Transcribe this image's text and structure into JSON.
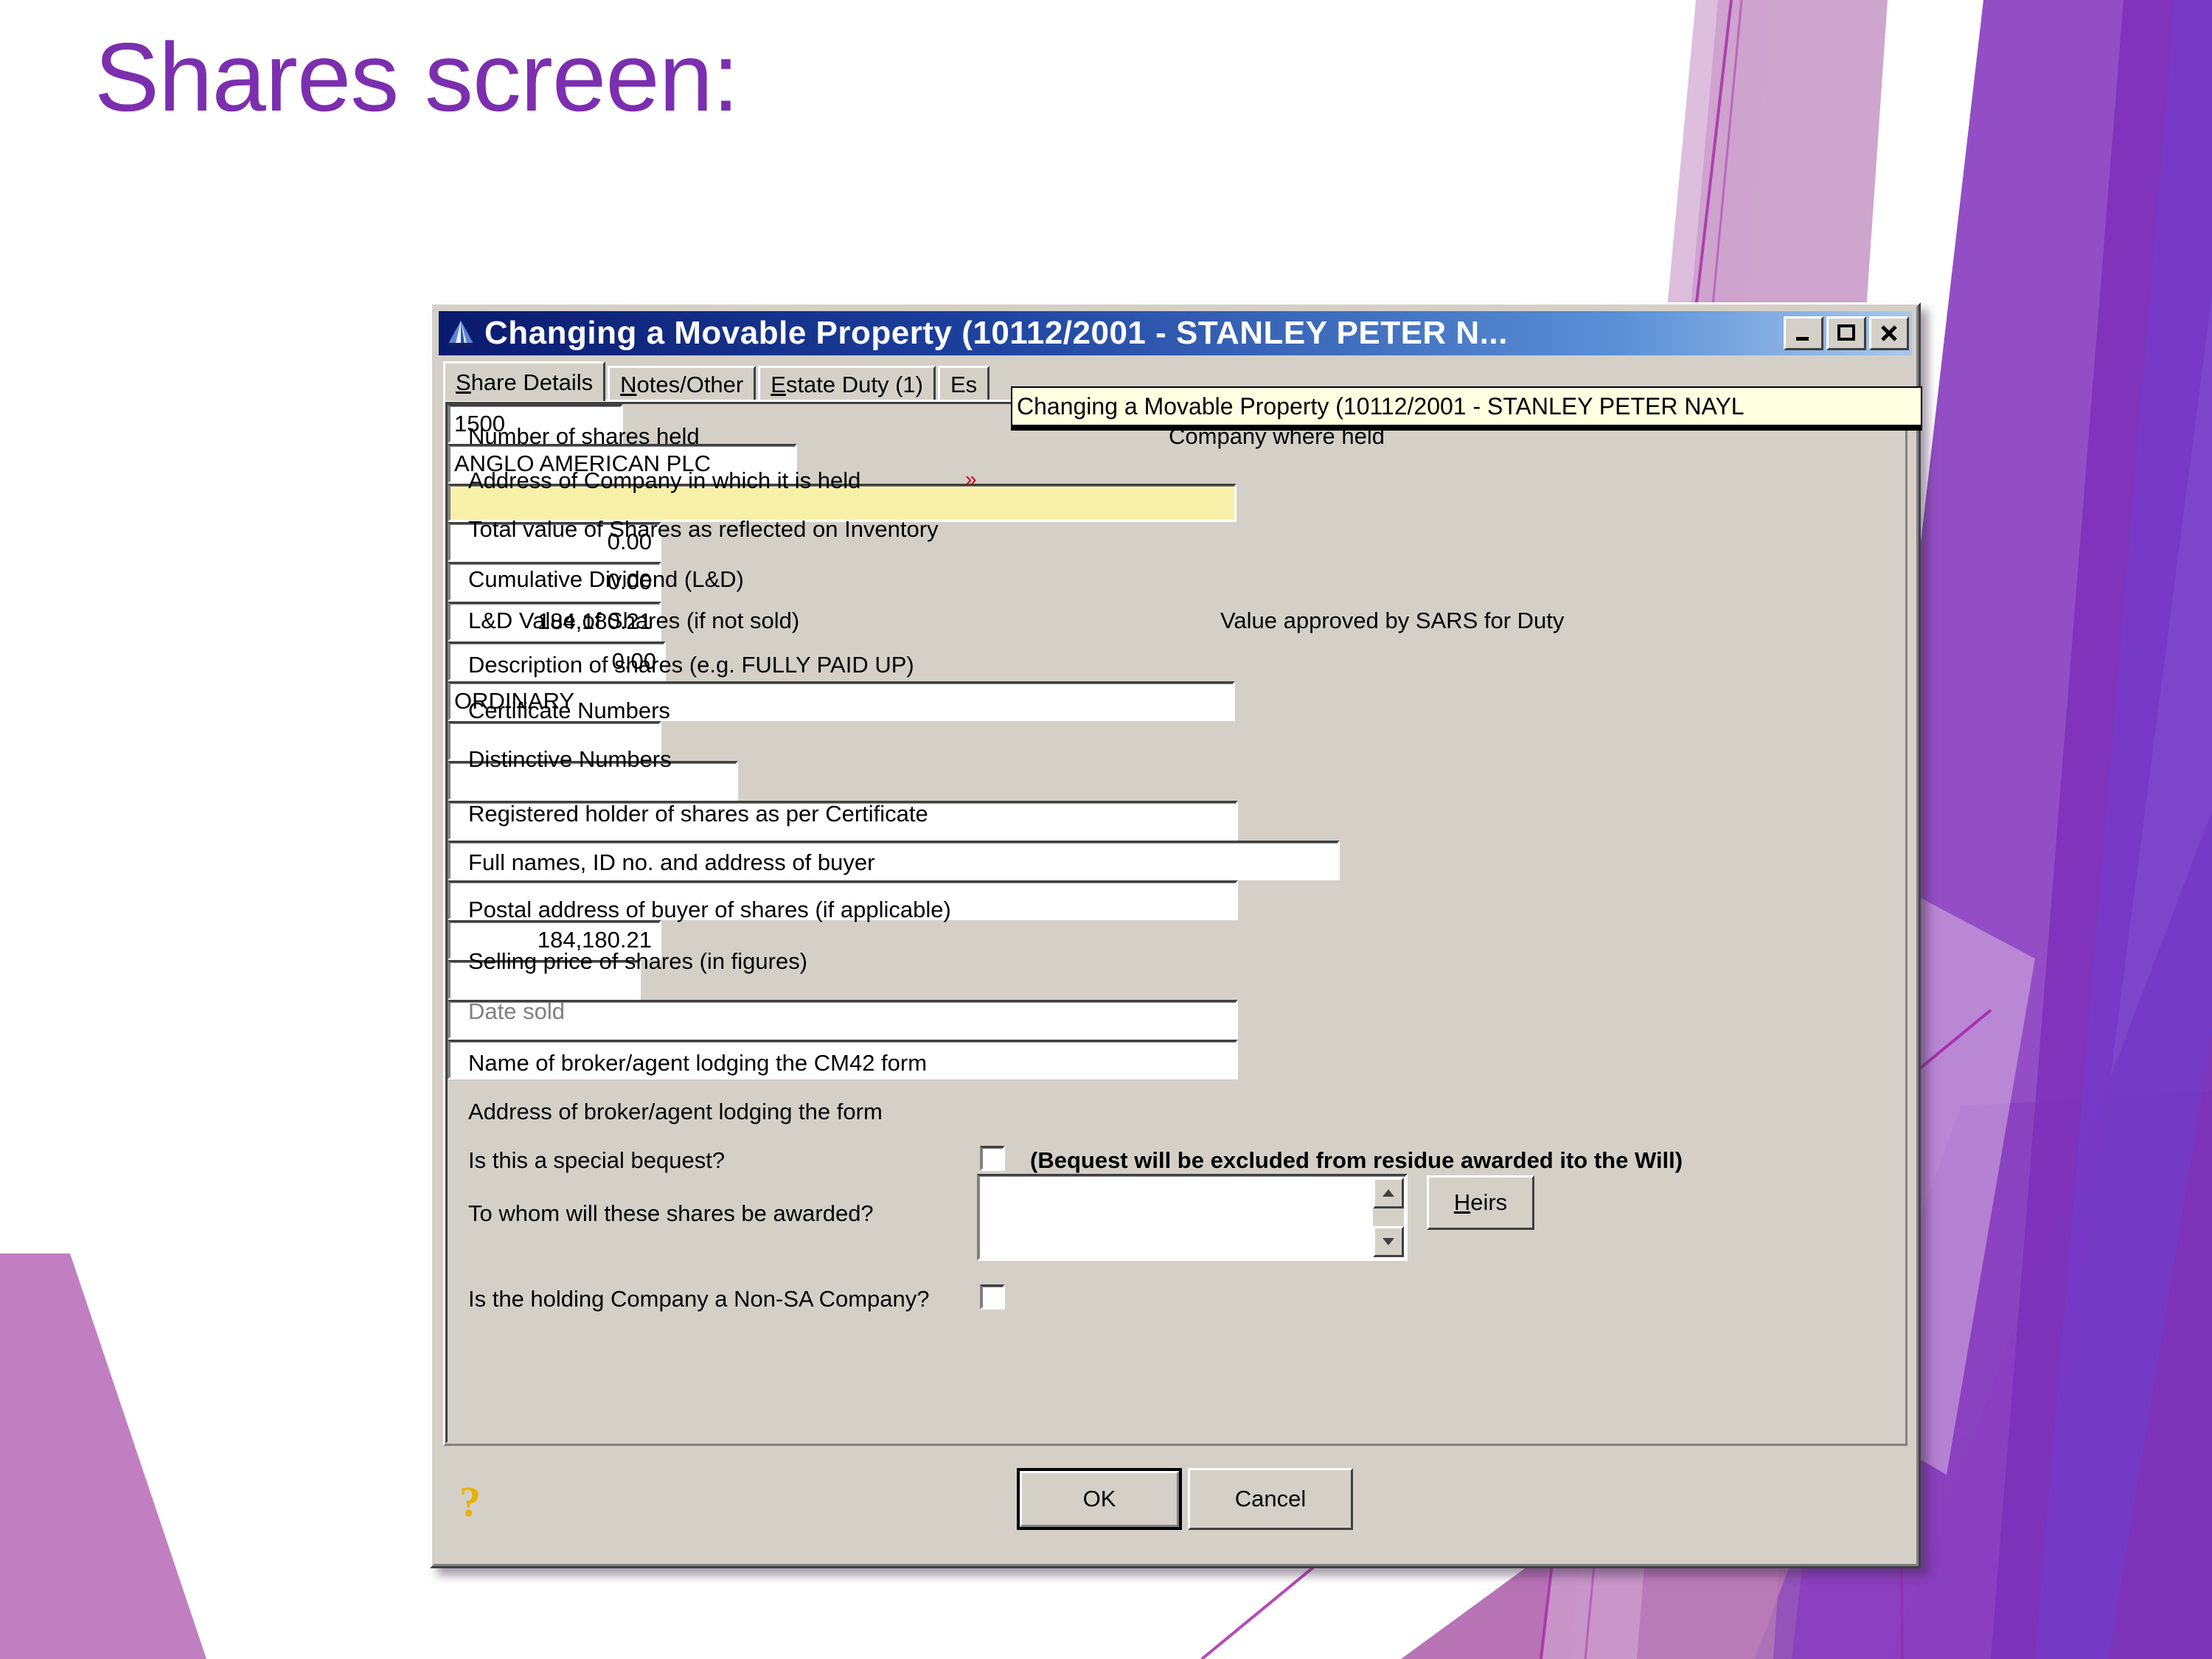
{
  "slide": {
    "title": "Shares screen:",
    "title_color": "#7B2FAF"
  },
  "dialog": {
    "title": "Changing a Movable Property  (10112/2001 - STANLEY PETER N...",
    "icon": "blue-triangle-icon",
    "window_buttons": {
      "minimize": "minimize-icon",
      "maximize": "maximize-icon",
      "close": "close-icon"
    },
    "tooltip": "Changing a Movable Property  (10112/2001 - STANLEY PETER NAYL",
    "tabs": [
      {
        "label": "Share Details",
        "accel": "S",
        "active": true
      },
      {
        "label": "Notes/Other",
        "accel": "N",
        "active": false
      },
      {
        "label": "Estate Duty (1)",
        "accel": "E",
        "active": false
      },
      {
        "label": "Es",
        "accel": "",
        "active": false
      }
    ],
    "fields": {
      "number_of_shares_held": {
        "label": "Number of shares held",
        "value": "1500"
      },
      "company_where_held": {
        "label": "Company where held",
        "value": "ANGLO AMERICAN PLC"
      },
      "address_of_company": {
        "label": "Address of Company in which it is held",
        "value": "",
        "required_marker": "»",
        "highlight": "#f7f0a8"
      },
      "total_value_inventory": {
        "label": "Total value of Shares as reflected on Inventory",
        "value": "0.00"
      },
      "cumulative_dividend": {
        "label": "Cumulative Dividend (L&D)",
        "value": "0.00"
      },
      "ld_value_of_shares": {
        "label": "L&D Value of Shares (if not sold)",
        "value": "184,180.21"
      },
      "value_approved_sars": {
        "label": "Value approved by SARS for Duty",
        "value": "0.00"
      },
      "description_of_shares": {
        "label": "Description of shares (e.g. FULLY PAID UP)",
        "value": "ORDINARY"
      },
      "certificate_numbers": {
        "label": "Certificate Numbers",
        "value": ""
      },
      "distinctive_numbers": {
        "label": "Distinctive Numbers",
        "value": ""
      },
      "registered_holder": {
        "label": "Registered holder of shares as per Certificate",
        "value": ""
      },
      "full_names_buyer": {
        "label": "Full names, ID no. and address of buyer",
        "value": ""
      },
      "postal_address_buyer": {
        "label": "Postal address of buyer of shares (if applicable)",
        "value": ""
      },
      "selling_price": {
        "label": "Selling price of shares (in figures)",
        "value": "184,180.21"
      },
      "date_sold": {
        "label": "Date sold",
        "value": "",
        "disabled": true
      },
      "broker_name": {
        "label": "Name of broker/agent lodging the CM42 form",
        "value": ""
      },
      "broker_address": {
        "label": "Address of broker/agent lodging the form",
        "value": ""
      },
      "special_bequest": {
        "label": "Is this a special bequest?",
        "checked": false,
        "note": "(Bequest will be excluded from residue awarded ito the Will)"
      },
      "awarded_to": {
        "label": "To whom will these shares be awarded?",
        "value": ""
      },
      "non_sa_company": {
        "label": "Is the holding Company a Non-SA Company?",
        "checked": false
      }
    },
    "buttons": {
      "heirs": "Heirs",
      "heirs_accel": "H",
      "ok": "OK",
      "cancel": "Cancel",
      "help": "?"
    }
  }
}
